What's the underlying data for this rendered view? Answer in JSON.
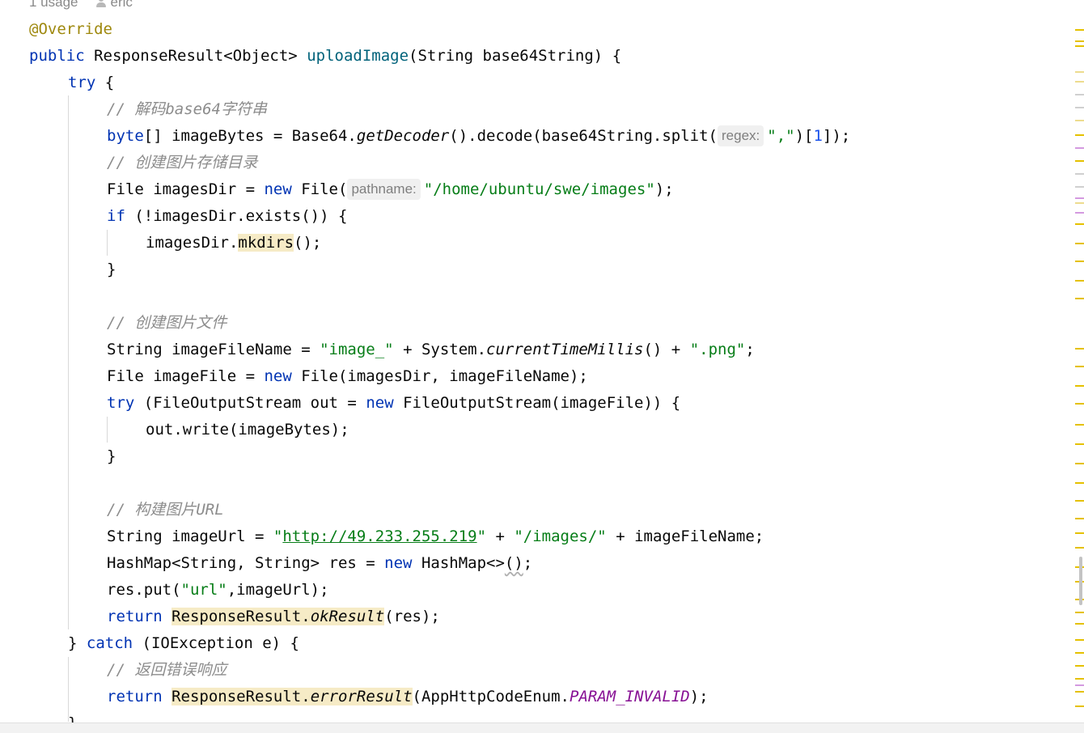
{
  "inlay": {
    "usages": "1 usage",
    "author": "eric"
  },
  "code": {
    "l1_ann": "@Override",
    "l2_kw": "public",
    "l2_type": " ResponseResult<Object> ",
    "l2_fn": "uploadImage",
    "l2_rest": "(String base64String) {",
    "l3_kw": "try",
    "l3_rest": " {",
    "l4_cmt": "// 解码base64字符串",
    "l5_kw": "byte",
    "l5_a": "[] imageBytes = Base64.",
    "l5_it": "getDecoder",
    "l5_b": "().decode(base64String.split(",
    "l5_hint": "regex:",
    "l5_str": "\",\"",
    "l5_c": ")[",
    "l5_num": "1",
    "l5_d": "]);",
    "l6_cmt": "// 创建图片存储目录",
    "l7_a": "File imagesDir = ",
    "l7_kw": "new",
    "l7_b": " File(",
    "l7_hint": "pathname:",
    "l7_str": "\"/home/ubuntu/swe/images\"",
    "l7_c": ");",
    "l8_kw": "if",
    "l8_rest": " (!imagesDir.exists()) {",
    "l9_a": "imagesDir.",
    "l9_hl": "mkdirs",
    "l9_b": "();",
    "l10": "}",
    "l12_cmt": "// 创建图片文件",
    "l13_a": "String imageFileName = ",
    "l13_s1": "\"image_\"",
    "l13_b": " + System.",
    "l13_it": "currentTimeMillis",
    "l13_c": "() + ",
    "l13_s2": "\".png\"",
    "l13_d": ";",
    "l14_a": "File imageFile = ",
    "l14_kw": "new",
    "l14_b": " File(imagesDir, imageFileName);",
    "l15_kw1": "try",
    "l15_a": " (FileOutputStream out = ",
    "l15_kw2": "new",
    "l15_b": " FileOutputStream(imageFile)) {",
    "l16": "out.write(imageBytes);",
    "l17": "}",
    "l19_cmt": "// 构建图片URL",
    "l20_a": "String imageUrl = ",
    "l20_q1": "\"",
    "l20_link": "http://49.233.255.219",
    "l20_q2": "\"",
    "l20_b": " + ",
    "l20_s": "\"/images/\"",
    "l20_c": " + imageFileName;",
    "l21_a": "HashMap<String, String> res = ",
    "l21_kw": "new",
    "l21_b": " HashMap<>",
    "l21_sq": "()",
    "l21_c": ";",
    "l22_a": "res.put(",
    "l22_s": "\"url\"",
    "l22_b": ",imageUrl);",
    "l23_kw": "return",
    "l23_sp": " ",
    "l23_h1": "ResponseResult.",
    "l23_hit": "okResult",
    "l23_b": "(res);",
    "l24_a": "} ",
    "l24_kw": "catch",
    "l24_b": " (IOException e) {",
    "l25_cmt": "// 返回错误响应",
    "l26_kw": "return",
    "l26_sp": " ",
    "l26_h1": "ResponseResult.",
    "l26_hit": "errorResult",
    "l26_b": "(AppHttpCodeEnum.",
    "l26_const": "PARAM_INVALID",
    "l26_c": ");",
    "l27": "}"
  },
  "colors": {
    "keyword": "#0033b3",
    "annotation": "#9e880d",
    "method_declaration": "#00627a",
    "string": "#067d17",
    "number": "#1750eb",
    "comment": "#8c8c8c",
    "constant": "#871094",
    "usage_highlight": "#f6ebc6"
  }
}
